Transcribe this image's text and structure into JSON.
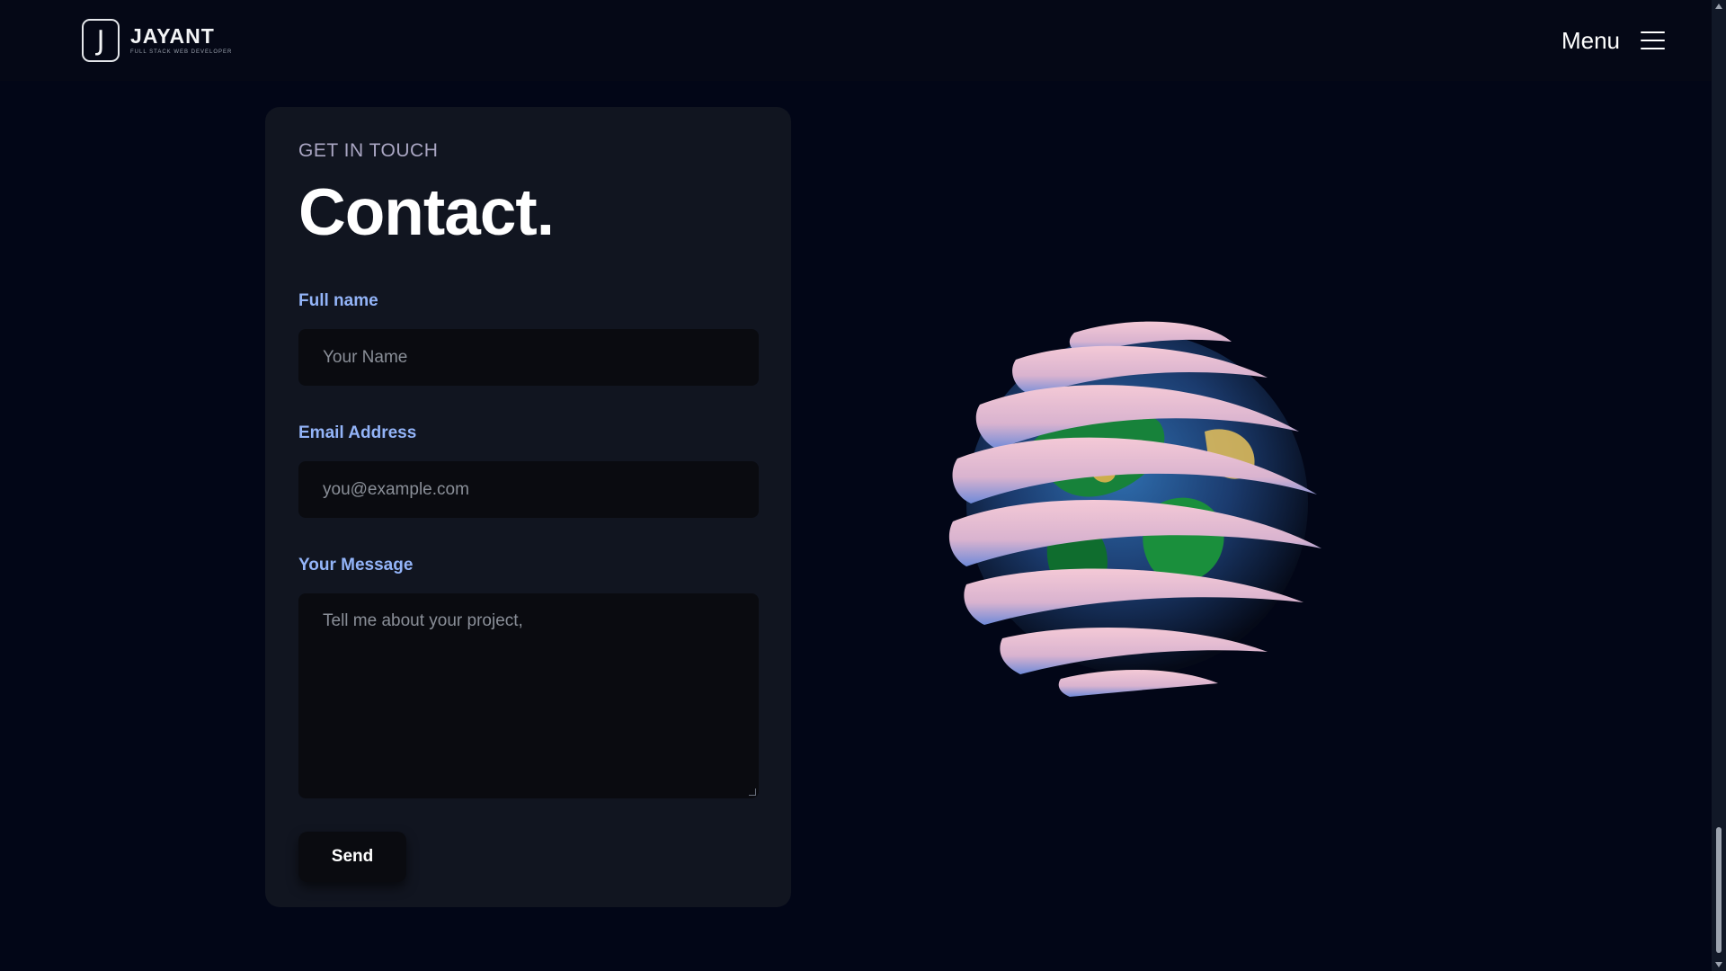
{
  "header": {
    "brand_name": "JAYANT",
    "brand_tagline": "FULL STACK WEB DEVELOPER",
    "brand_initial": "J",
    "menu_label": "Menu"
  },
  "contact": {
    "eyebrow": "GET IN TOUCH",
    "title": "Contact.",
    "fields": {
      "name": {
        "label": "Full name",
        "placeholder": "Your Name",
        "value": ""
      },
      "email": {
        "label": "Email Address",
        "placeholder": "you@example.com",
        "value": ""
      },
      "message": {
        "label": "Your Message",
        "placeholder": "Tell me about your project,",
        "value": ""
      }
    },
    "submit_label": "Send"
  },
  "icons": {
    "logo": "logo-icon",
    "menu": "hamburger-icon",
    "globe": "earth-globe-icon"
  },
  "colors": {
    "page_background": "#020617",
    "header_background": "#050816",
    "card_background": "#111520",
    "input_background": "#0a0b10",
    "label_accent": "#93b4f8",
    "eyebrow_text": "#aaa6c3"
  }
}
